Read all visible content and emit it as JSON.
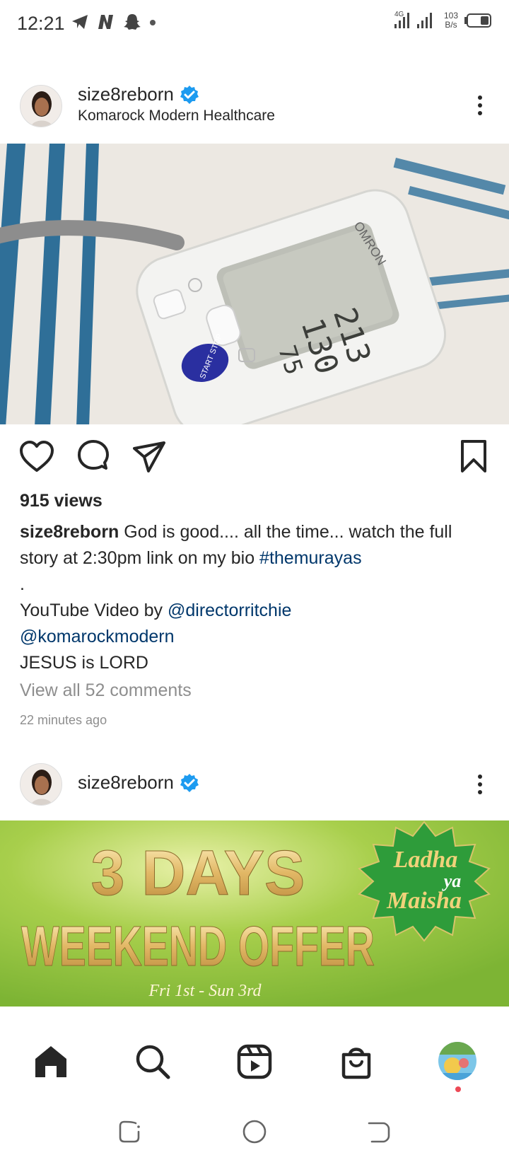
{
  "status_bar": {
    "time": "12:21",
    "net_speed_value": "103",
    "net_speed_unit": "B/s",
    "network_label": "4G",
    "icons": [
      "telegram-icon",
      "n-app-icon",
      "snapchat-icon",
      "dot-icon",
      "signal-icon",
      "battery-icon"
    ]
  },
  "post1": {
    "username": "size8reborn",
    "location": "Komarock Modern Healthcare",
    "image_texts": {
      "brand": "OMRON",
      "start_button": "START STOP",
      "reading_sys": "213",
      "reading_dia": "130",
      "reading_pulse": "75"
    },
    "views": "915 views",
    "caption_user": "size8reborn",
    "caption_text": " God is good.... all the time... watch the full story at 2:30pm link on my bio ",
    "caption_hashtag": "#themurayas",
    "caption_dot": ".",
    "caption_line2_prefix": "YouTube Video by ",
    "caption_mention1": "@directorritchie",
    "caption_mention2": "@komarockmodern",
    "caption_line4": "JESUS is LORD",
    "view_all_comments": "View all 52 comments",
    "time_ago": "22 minutes ago"
  },
  "post2": {
    "username": "size8reborn",
    "banner_title_1": "3 DAYS",
    "banner_title_2": "WEEKEND OFFER",
    "banner_dates": "Fri 1st - Sun 3rd",
    "badge_line1": "Ladha",
    "badge_line2": "ya",
    "badge_line3": "Maisha"
  },
  "colors": {
    "verified": "#1d9bf0",
    "link": "#00376b",
    "muted": "#8e8e8e",
    "banner_green": "#8cc63f",
    "notification_dot": "#ed4956"
  }
}
